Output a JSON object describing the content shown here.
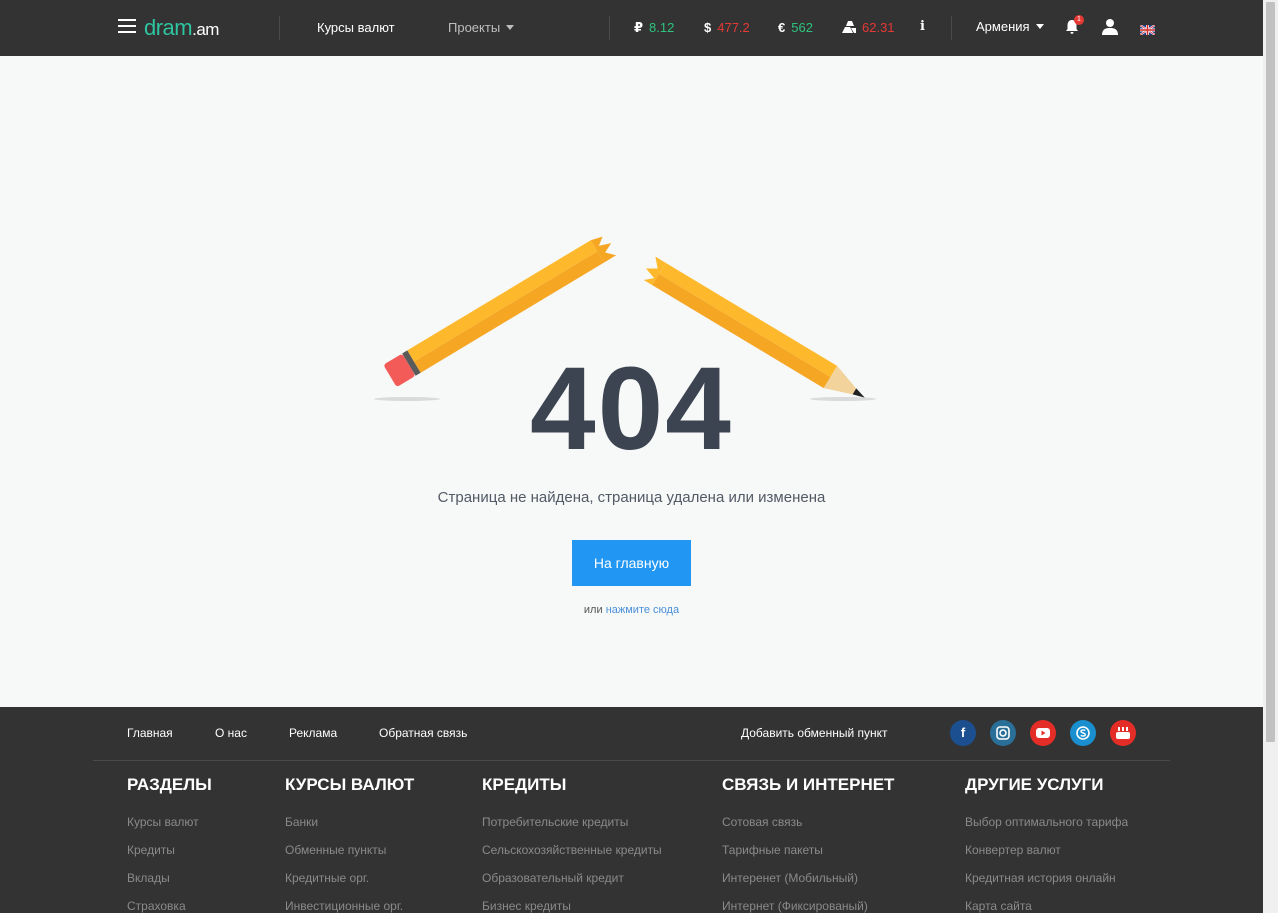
{
  "header": {
    "logo_main": "dram",
    "logo_ext": ".am",
    "nav": [
      {
        "label": "Курсы валют"
      },
      {
        "label": "Проекты"
      }
    ],
    "rates": [
      {
        "symbol": "₽",
        "value": "8.12",
        "trend": "up"
      },
      {
        "symbol": "$",
        "value": "477.2",
        "trend": "down"
      },
      {
        "symbol": "€",
        "value": "562",
        "trend": "up"
      },
      {
        "symbol": "gold",
        "value": "62.31",
        "trend": "down"
      }
    ],
    "info_label": "i",
    "country": "Армения",
    "notification_count": "1",
    "icons": [
      "menu-icon",
      "ruble-icon",
      "dollar-icon",
      "euro-icon",
      "gold-bar-icon",
      "info-icon",
      "bell-icon",
      "user-icon",
      "uk-flag-icon"
    ],
    "colors": {
      "bar": "#333333",
      "brand": "#2ec4a0",
      "up": "#2ec27e",
      "down": "#e53935"
    }
  },
  "main": {
    "code": "404",
    "message": "Страница не найдена, страница удалена или изменена",
    "home_button": "На главную",
    "or_text": "или",
    "alt_link": "нажмите сюда",
    "illustration": "broken-pencil",
    "colors": {
      "button": "#2196f3",
      "code": "#3c4451"
    }
  },
  "footer": {
    "links": [
      "Главная",
      "О нас",
      "Реклама",
      "Обратная связь"
    ],
    "add_point": "Добавить обменный пункт",
    "social": [
      "facebook-icon",
      "instagram-icon",
      "youtube-icon",
      "skype-icon",
      "youtube-classic-icon"
    ],
    "columns": [
      {
        "title": "РАЗДЕЛЫ",
        "items": [
          "Курсы валют",
          "Кредиты",
          "Вклады",
          "Страховка"
        ]
      },
      {
        "title": "КУРСЫ ВАЛЮТ",
        "items": [
          "Банки",
          "Обменные пункты",
          "Кредитные орг.",
          "Инвестиционные орг."
        ]
      },
      {
        "title": "КРЕДИТЫ",
        "items": [
          "Потребительские кредиты",
          "Сельскохозяйственные кредиты",
          "Образовательный кредит",
          "Бизнес кредиты"
        ]
      },
      {
        "title": "СВЯЗЬ И ИНТЕРНЕТ",
        "items": [
          "Сотовая связь",
          "Тарифные пакеты",
          "Интеренет (Мобильный)",
          "Интернет (Фиксированый)"
        ]
      },
      {
        "title": "ДРУГИЕ УСЛУГИ",
        "items": [
          "Выбор оптимального тарифа",
          "Конвертер валют",
          "Кредитная история онлайн",
          "Карта сайта"
        ]
      }
    ]
  }
}
